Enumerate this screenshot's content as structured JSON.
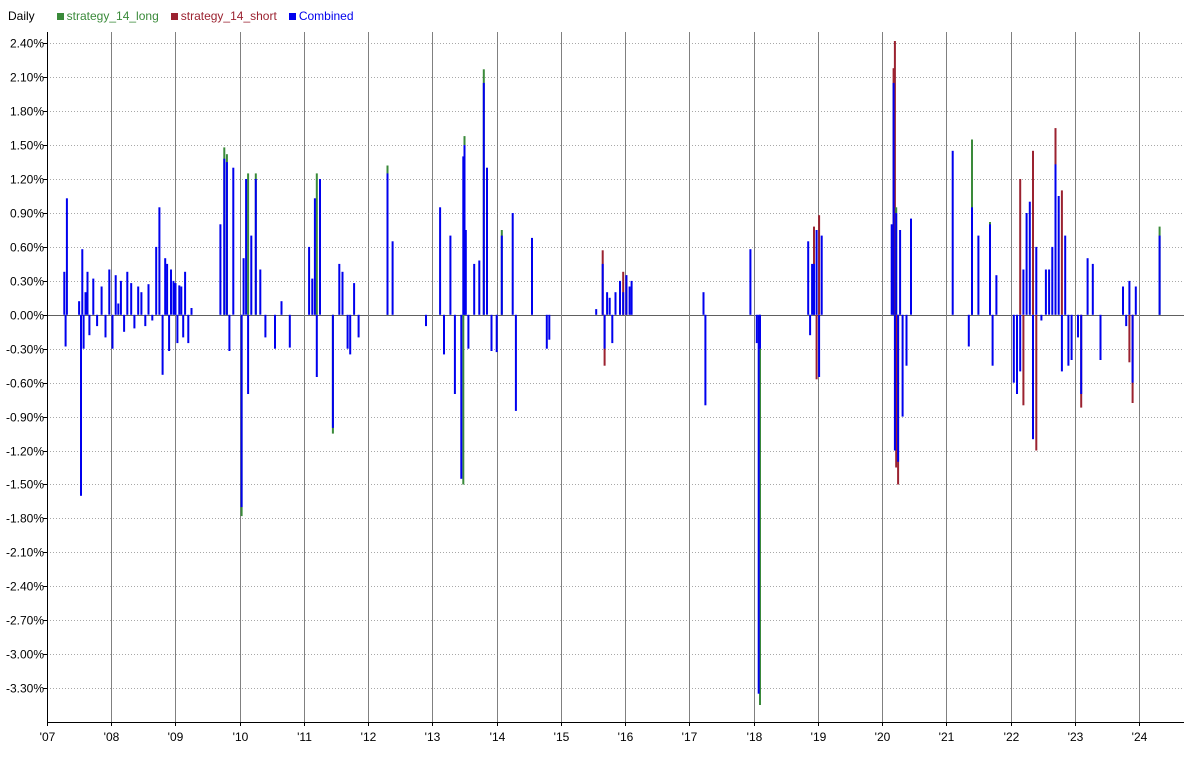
{
  "header": {
    "title": "Daily"
  },
  "legend": [
    {
      "name": "strategy_14_long",
      "color": "#3a8a3a"
    },
    {
      "name": "strategy_14_short",
      "color": "#9b2230"
    },
    {
      "name": "Combined",
      "color": "#0000ee"
    }
  ],
  "chart_data": {
    "type": "bar",
    "title": "Daily",
    "xlabel": "",
    "ylabel": "",
    "ylim": [
      -3.6,
      2.5
    ],
    "xlim": [
      2007.0,
      2024.7
    ],
    "grid": {
      "x": true,
      "y": true
    },
    "legend_position": "top-left",
    "y_ticks": [
      2.4,
      2.1,
      1.8,
      1.5,
      1.2,
      0.9,
      0.6,
      0.3,
      0.0,
      -0.3,
      -0.6,
      -0.9,
      -1.2,
      -1.5,
      -1.8,
      -2.1,
      -2.4,
      -2.7,
      -3.0,
      -3.3
    ],
    "y_tick_labels": [
      "2.40%",
      "2.10%",
      "1.80%",
      "1.50%",
      "1.20%",
      "0.90%",
      "0.60%",
      "0.30%",
      "0.00%",
      "-0.30%",
      "-0.60%",
      "-0.90%",
      "-1.20%",
      "-1.50%",
      "-1.80%",
      "-2.10%",
      "-2.40%",
      "-2.70%",
      "-3.00%",
      "-3.30%"
    ],
    "x_ticks": [
      2007,
      2008,
      2009,
      2010,
      2011,
      2012,
      2013,
      2014,
      2015,
      2016,
      2017,
      2018,
      2019,
      2020,
      2021,
      2022,
      2023,
      2024
    ],
    "x_tick_labels": [
      "'07",
      "'08",
      "'09",
      "'10",
      "'11",
      "'12",
      "'13",
      "'14",
      "'15",
      "'16",
      "'17",
      "'18",
      "'19",
      "'20",
      "'21",
      "'22",
      "'23",
      "'24"
    ],
    "series": [
      {
        "name": "Combined",
        "color": "#0000ee",
        "x": [
          2007.27,
          2007.29,
          2007.31,
          2007.5,
          2007.53,
          2007.55,
          2007.57,
          2007.6,
          2007.63,
          2007.66,
          2007.72,
          2007.78,
          2007.85,
          2007.91,
          2007.97,
          2008.02,
          2008.07,
          2008.11,
          2008.15,
          2008.2,
          2008.25,
          2008.31,
          2008.36,
          2008.42,
          2008.47,
          2008.53,
          2008.58,
          2008.64,
          2008.7,
          2008.75,
          2008.8,
          2008.84,
          2008.87,
          2008.9,
          2008.93,
          2008.97,
          2009.0,
          2009.03,
          2009.06,
          2009.09,
          2009.12,
          2009.15,
          2009.2,
          2009.25,
          2009.7,
          2009.76,
          2009.8,
          2009.84,
          2009.9,
          2010.03,
          2010.06,
          2010.1,
          2010.13,
          2010.18,
          2010.25,
          2010.32,
          2010.4,
          2010.55,
          2010.65,
          2010.78,
          2011.08,
          2011.13,
          2011.17,
          2011.2,
          2011.25,
          2011.45,
          2011.55,
          2011.6,
          2011.68,
          2011.72,
          2011.78,
          2011.85,
          2012.3,
          2012.38,
          2012.9,
          2013.12,
          2013.18,
          2013.28,
          2013.35,
          2013.45,
          2013.48,
          2013.5,
          2013.52,
          2013.56,
          2013.65,
          2013.73,
          2013.8,
          2013.85,
          2013.92,
          2014.0,
          2014.08,
          2014.25,
          2014.3,
          2014.55,
          2014.78,
          2014.82,
          2015.55,
          2015.65,
          2015.68,
          2015.72,
          2015.76,
          2015.8,
          2015.85,
          2015.92,
          2015.97,
          2016.02,
          2016.07,
          2016.1,
          2017.22,
          2017.25,
          2017.95,
          2018.05,
          2018.08,
          2018.1,
          2018.85,
          2018.88,
          2018.91,
          2018.94,
          2018.98,
          2019.02,
          2019.06,
          2020.15,
          2020.18,
          2020.2,
          2020.22,
          2020.25,
          2020.28,
          2020.32,
          2020.38,
          2020.45,
          2021.1,
          2021.35,
          2021.4,
          2021.5,
          2021.68,
          2021.72,
          2021.78,
          2022.05,
          2022.1,
          2022.15,
          2022.2,
          2022.25,
          2022.3,
          2022.35,
          2022.4,
          2022.48,
          2022.55,
          2022.6,
          2022.65,
          2022.7,
          2022.75,
          2022.8,
          2022.85,
          2022.9,
          2022.95,
          2023.05,
          2023.1,
          2023.2,
          2023.28,
          2023.4,
          2023.75,
          2023.8,
          2023.85,
          2023.9,
          2023.95,
          2024.32
        ],
        "values": [
          0.38,
          -0.28,
          1.03,
          0.12,
          -1.6,
          0.58,
          -0.3,
          0.2,
          0.38,
          -0.18,
          0.32,
          -0.1,
          0.25,
          -0.2,
          0.4,
          -0.3,
          0.35,
          0.1,
          0.3,
          -0.15,
          0.38,
          0.28,
          -0.12,
          0.25,
          0.2,
          -0.1,
          0.27,
          -0.05,
          0.6,
          0.95,
          -0.53,
          0.5,
          0.45,
          -0.32,
          0.4,
          0.3,
          0.28,
          -0.25,
          0.26,
          0.25,
          -0.2,
          0.38,
          -0.25,
          0.06,
          0.8,
          1.38,
          1.35,
          -0.32,
          1.3,
          -1.7,
          0.5,
          1.2,
          -0.7,
          0.7,
          1.2,
          0.4,
          -0.2,
          -0.3,
          0.12,
          -0.29,
          0.6,
          0.32,
          1.03,
          -0.55,
          1.2,
          -1.0,
          0.45,
          0.38,
          -0.3,
          -0.35,
          0.28,
          -0.2,
          1.25,
          0.65,
          -0.1,
          0.95,
          -0.35,
          0.7,
          -0.7,
          -1.45,
          1.4,
          1.5,
          0.75,
          -0.3,
          0.45,
          0.48,
          2.05,
          1.3,
          -0.32,
          -0.33,
          0.7,
          0.9,
          -0.85,
          0.68,
          -0.3,
          -0.22,
          0.05,
          0.45,
          -0.3,
          0.2,
          0.15,
          -0.25,
          0.2,
          0.3,
          0.2,
          0.35,
          0.25,
          0.3,
          0.2,
          -0.8,
          0.58,
          -0.25,
          -3.35,
          -0.3,
          0.65,
          -0.18,
          0.45,
          0.45,
          0.75,
          -0.55,
          0.7,
          0.8,
          2.05,
          -1.2,
          0.9,
          -1.3,
          0.75,
          -0.9,
          -0.45,
          0.85,
          1.45,
          -0.28,
          0.95,
          0.7,
          0.8,
          -0.45,
          0.35,
          -0.6,
          -0.7,
          -0.5,
          0.4,
          0.9,
          1.0,
          -1.1,
          0.6,
          -0.05,
          0.4,
          0.4,
          0.6,
          1.33,
          1.05,
          -0.5,
          0.7,
          -0.45,
          -0.4,
          -0.2,
          -0.7,
          0.5,
          0.45,
          -0.4,
          0.25,
          -0.1,
          0.3,
          -0.6,
          0.25,
          0.7
        ]
      },
      {
        "name": "strategy_14_long",
        "color": "#3a8a3a",
        "x": [
          2009.76,
          2009.8,
          2010.03,
          2010.13,
          2010.25,
          2011.2,
          2011.45,
          2012.3,
          2013.5,
          2013.48,
          2013.8,
          2014.08,
          2020.22,
          2021.4,
          2021.68,
          2024.32,
          2018.1
        ],
        "values": [
          1.48,
          1.42,
          -1.78,
          1.25,
          1.25,
          1.25,
          -1.05,
          1.32,
          1.58,
          -1.5,
          2.17,
          0.75,
          0.95,
          1.55,
          0.82,
          0.78,
          -3.45
        ]
      },
      {
        "name": "strategy_14_short",
        "color": "#9b2230",
        "x": [
          2015.65,
          2015.68,
          2015.97,
          2016.02,
          2018.94,
          2018.98,
          2019.02,
          2020.18,
          2020.2,
          2020.22,
          2020.25,
          2022.15,
          2022.2,
          2022.35,
          2022.4,
          2022.7,
          2022.8,
          2023.1,
          2023.85,
          2023.9
        ],
        "values": [
          0.57,
          -0.45,
          0.38,
          0.35,
          0.78,
          -0.57,
          0.88,
          2.18,
          2.42,
          -1.35,
          -1.5,
          1.2,
          -0.8,
          1.45,
          -1.2,
          1.65,
          1.1,
          -0.82,
          -0.42,
          -0.78
        ]
      }
    ]
  }
}
